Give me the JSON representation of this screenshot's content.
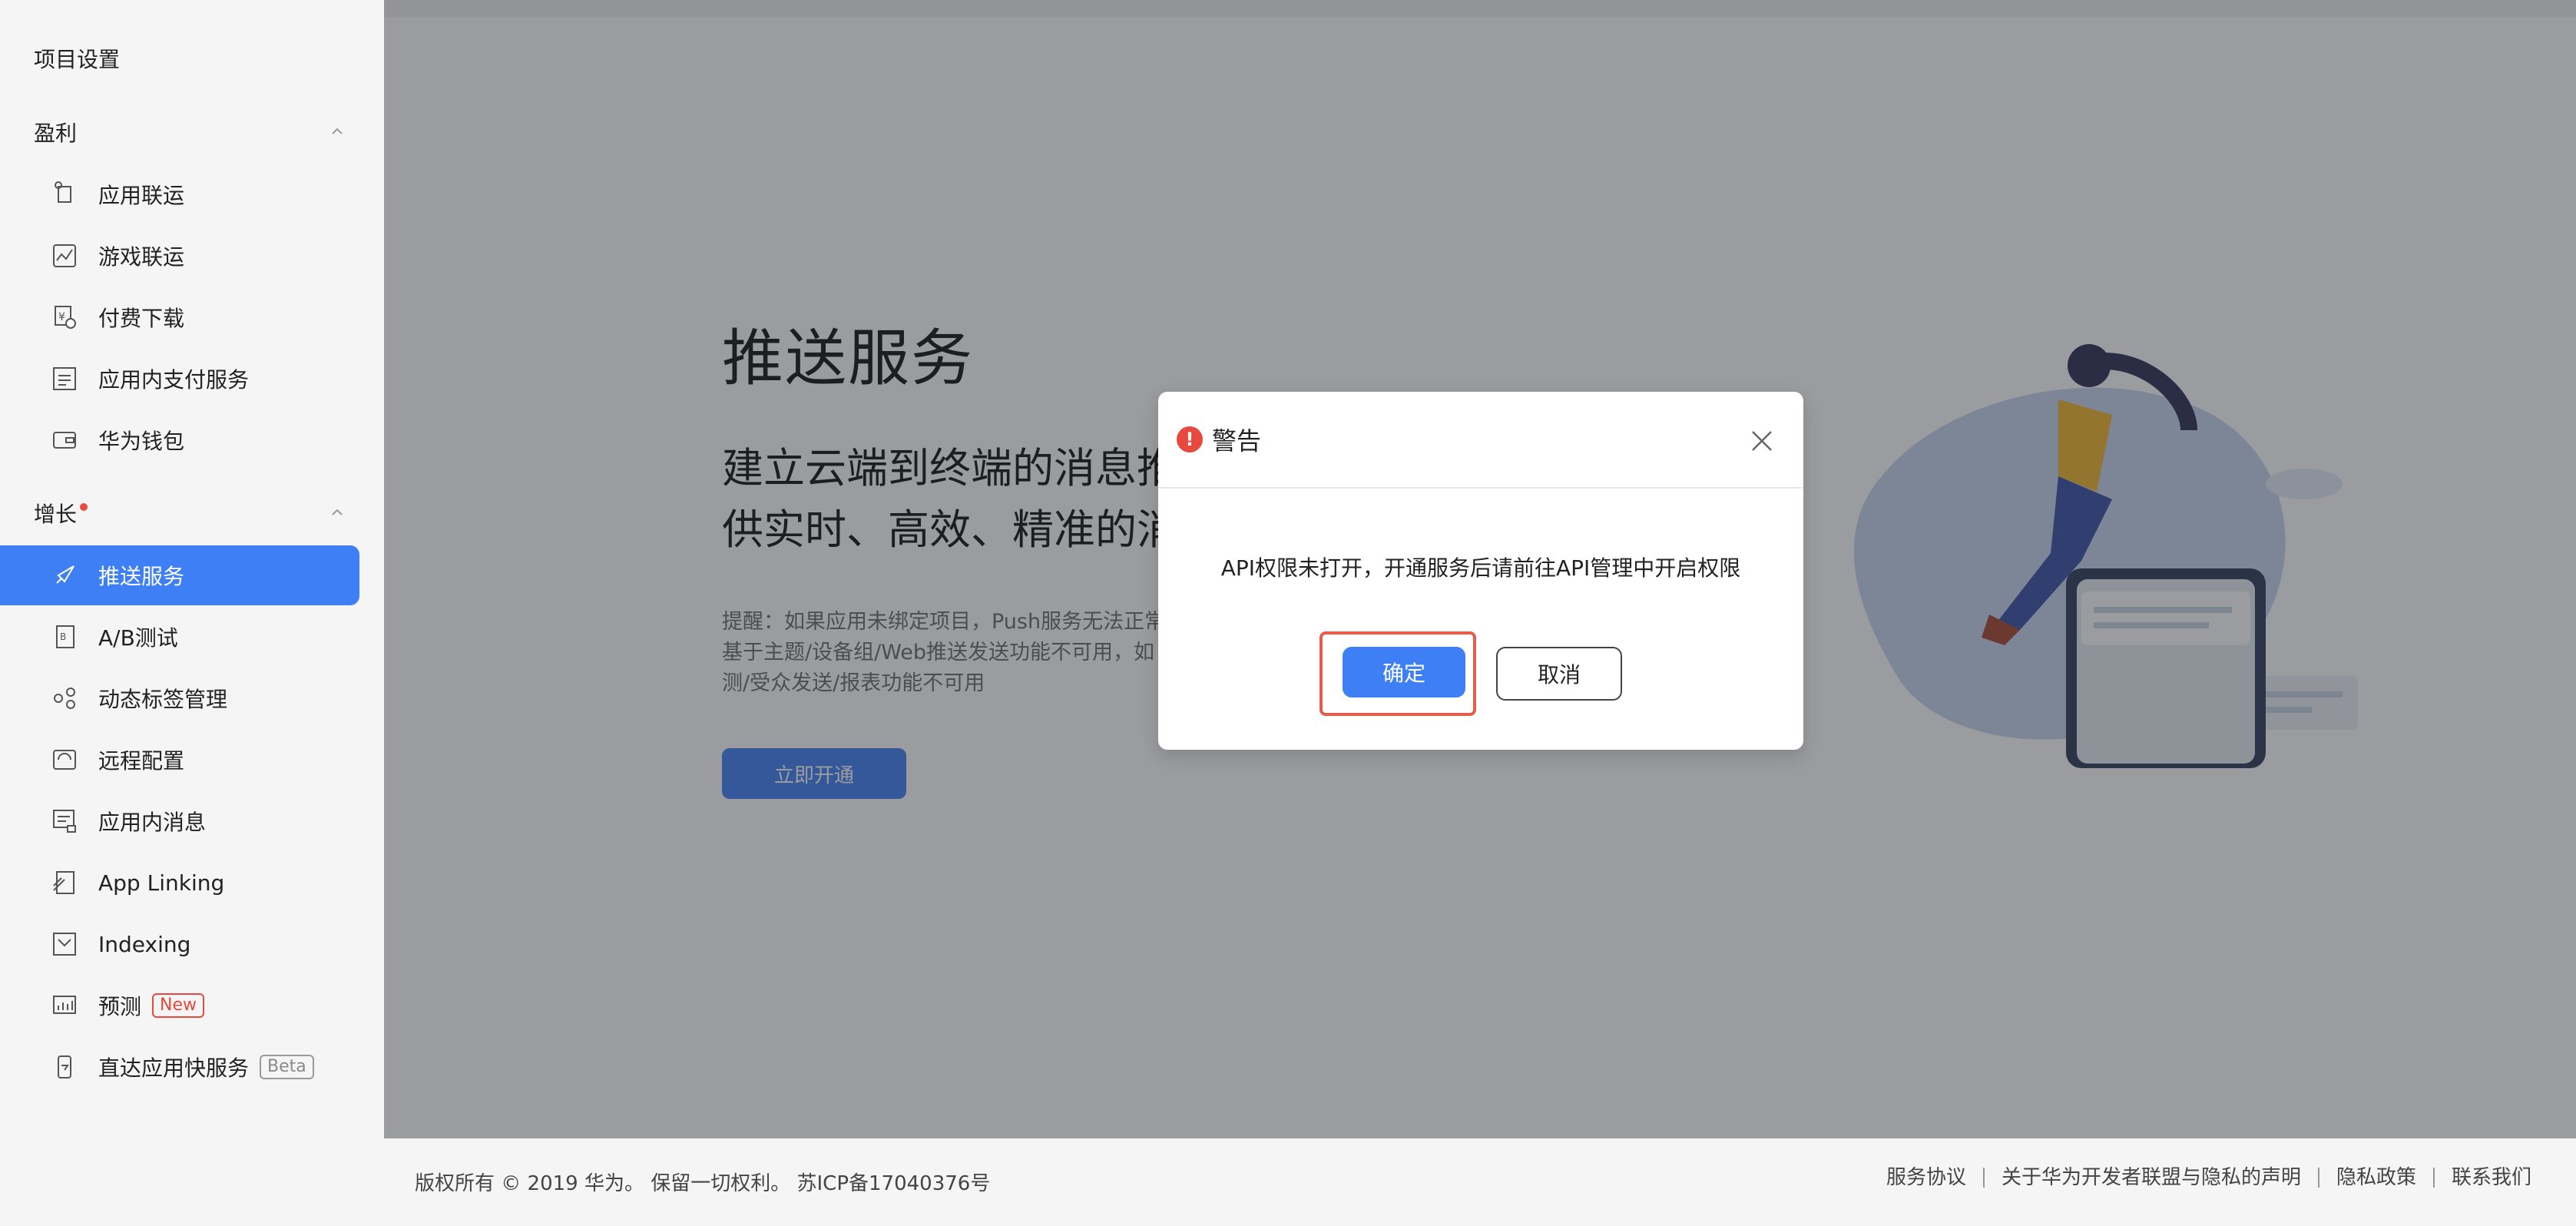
{
  "sidebar": {
    "title": "项目设置",
    "sections": [
      {
        "label": "盈利"
      },
      {
        "label": "增长",
        "has_dot": true
      }
    ],
    "items": [
      {
        "label": "应用联运",
        "icon": "shortcut-icon"
      },
      {
        "label": "游戏联运",
        "icon": "chart-icon"
      },
      {
        "label": "付费下载",
        "icon": "price-download-icon"
      },
      {
        "label": "应用内支付服务",
        "icon": "receipt-icon"
      },
      {
        "label": "华为钱包",
        "icon": "wallet-icon"
      },
      {
        "label": "推送服务",
        "icon": "rocket-icon",
        "active": true
      },
      {
        "label": "A/B测试",
        "icon": "ab-test-icon"
      },
      {
        "label": "动态标签管理",
        "icon": "tag-manager-icon"
      },
      {
        "label": "远程配置",
        "icon": "remote-config-icon"
      },
      {
        "label": "应用内消息",
        "icon": "in-app-message-icon"
      },
      {
        "label": "App Linking",
        "icon": "link-icon"
      },
      {
        "label": "Indexing",
        "icon": "indexing-icon"
      },
      {
        "label": "预测",
        "icon": "prediction-icon",
        "badge": "New"
      },
      {
        "label": "直达应用快服务",
        "icon": "quick-service-icon",
        "badge": "Beta"
      }
    ]
  },
  "main": {
    "title": "推送服务",
    "subtitle": "建立云端到终端的消息推\n供实时、高效、精准的消",
    "note": "提醒：如果应用未绑定项目，Push服务无法正常\n基于主题/设备组/Web推送发送功能不可用，如\n测/受众发送/报表功能不可用",
    "open_button": "立即开通"
  },
  "dialog": {
    "title": "警告",
    "message": "API权限未打开，开通服务后请前往API管理中开启权限",
    "confirm": "确定",
    "cancel": "取消"
  },
  "footer": {
    "copyright": "版权所有 © 2019 华为。 保留一切权利。 苏ICP备17040376号",
    "links": [
      "服务协议",
      "关于华为开发者联盟与隐私的声明",
      "隐私政策",
      "联系我们"
    ]
  },
  "colors": {
    "accent": "#3f7ff5",
    "warning": "#e8483d",
    "overlay": "rgba(40,44,52,0.47)"
  }
}
